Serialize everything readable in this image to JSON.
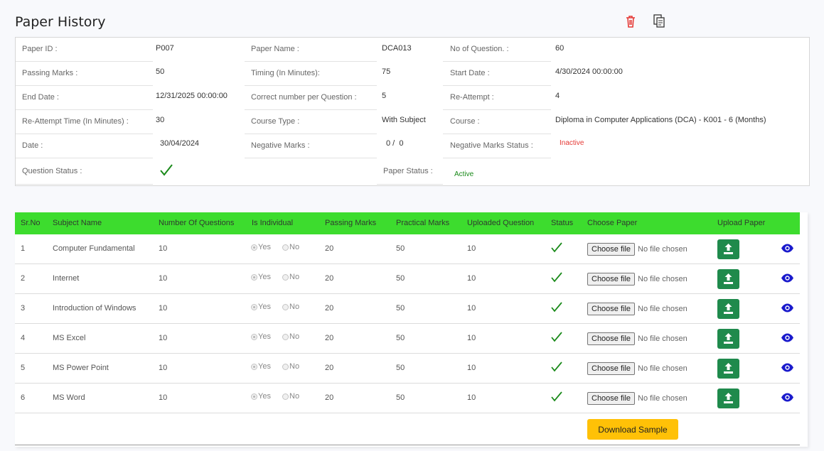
{
  "page_title": "Paper History",
  "info": {
    "paper_id_label": "Paper ID :",
    "paper_id": "P007",
    "paper_name_label": "Paper Name :",
    "paper_name": "DCA013",
    "no_questions_label": "No of Question. :",
    "no_questions": "60",
    "passing_marks_label": "Passing Marks :",
    "passing_marks": "50",
    "timing_label": "Timing (In Minutes):",
    "timing": "75",
    "start_date_label": "Start Date :",
    "start_date": "4/30/2024 00:00:00",
    "end_date_label": "End Date :",
    "end_date": "12/31/2025 00:00:00",
    "correct_label": "Correct number per Question :",
    "correct": "5",
    "reattempt_label": "Re-Attempt :",
    "reattempt": "4",
    "reattempt_time_label": "Re-Attempt Time (In Minutes) :",
    "reattempt_time": "30",
    "course_type_label": "Course Type :",
    "course_type": "With Subject",
    "course_label": "Course :",
    "course": "Diploma in Computer Applications (DCA) - K001 - 6 (Months)",
    "date_label": "Date :",
    "date": "30/04/2024",
    "negative_marks_label": "Negative Marks :",
    "negative_marks": "0 /  0",
    "neg_status_label": "Negative Marks Status :",
    "neg_status": "Inactive",
    "question_status_label": "Question Status :",
    "paper_status_label": "Paper Status :",
    "paper_status": "Active"
  },
  "table": {
    "headers": [
      "Sr.No",
      "Subject Name",
      "Number Of Questions",
      "Is Individual",
      "Passing Marks",
      "Practical Marks",
      "Uploaded Question",
      "Status",
      "Choose Paper",
      "Upload Paper"
    ],
    "yes_label": "Yes",
    "no_label": "No",
    "choose_file_label": "Choose file",
    "no_file_label": "No file chosen",
    "rows": [
      {
        "sr": "1",
        "subject": "Computer Fundamental",
        "questions": "10",
        "passing": "20",
        "practical": "50",
        "uploaded": "10"
      },
      {
        "sr": "2",
        "subject": "Internet",
        "questions": "10",
        "passing": "20",
        "practical": "50",
        "uploaded": "10"
      },
      {
        "sr": "3",
        "subject": "Introduction of Windows",
        "questions": "10",
        "passing": "20",
        "practical": "50",
        "uploaded": "10"
      },
      {
        "sr": "4",
        "subject": "MS Excel",
        "questions": "10",
        "passing": "20",
        "practical": "50",
        "uploaded": "10"
      },
      {
        "sr": "5",
        "subject": "MS Power Point",
        "questions": "10",
        "passing": "20",
        "practical": "50",
        "uploaded": "10"
      },
      {
        "sr": "6",
        "subject": "MS Word",
        "questions": "10",
        "passing": "20",
        "practical": "50",
        "uploaded": "10"
      }
    ],
    "download_label": "Download Sample"
  },
  "colors": {
    "header_green": "#3ddc2e",
    "check_green": "#1a8a1a",
    "inactive_red": "#e53935",
    "active_green": "#1a8a1a",
    "upload_btn": "#1f8a4c",
    "download_btn": "#ffc107",
    "eye_blue": "#1a1acc"
  },
  "icons": [
    "trash-icon",
    "copy-icon",
    "check-icon",
    "upload-icon",
    "eye-icon"
  ]
}
